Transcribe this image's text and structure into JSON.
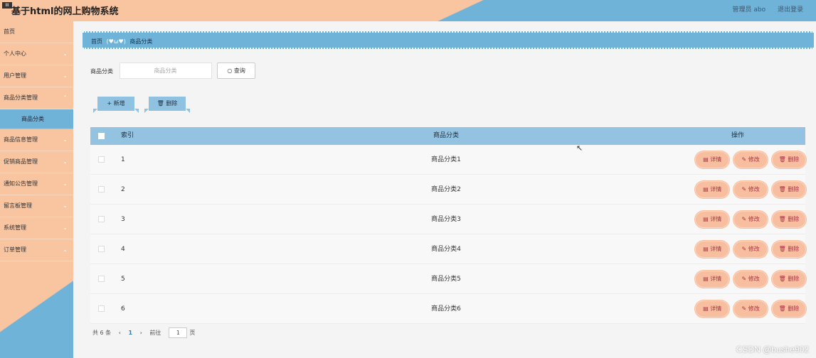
{
  "header": {
    "logo_text": "III",
    "title": "基于html的网上购物系统",
    "user_label": "管理员 abo",
    "logout_label": "退出登录"
  },
  "sidebar": {
    "items": [
      {
        "label": "首页",
        "chevron": false
      },
      {
        "label": "个人中心",
        "chevron": true
      },
      {
        "label": "用户管理",
        "chevron": true
      },
      {
        "label": "商品分类管理",
        "chevron": true
      },
      {
        "label": "商品分类",
        "sub": true
      },
      {
        "label": "商品信息管理",
        "chevron": true
      },
      {
        "label": "促销商品管理",
        "chevron": true
      },
      {
        "label": "通知公告管理",
        "chevron": true
      },
      {
        "label": "留言板管理",
        "chevron": true
      },
      {
        "label": "系统管理",
        "chevron": true
      },
      {
        "label": "订单管理",
        "chevron": true
      }
    ]
  },
  "breadcrumb": {
    "home": "首页",
    "decoration": "(♥ω♥)",
    "current": "商品分类"
  },
  "search": {
    "label": "商品分类",
    "placeholder": "商品分类",
    "query_button": "查询"
  },
  "actions": {
    "add_label": "新增",
    "delete_label": "删除"
  },
  "table": {
    "headers": {
      "index": "索引",
      "category": "商品分类",
      "ops": "操作"
    },
    "rows": [
      {
        "index": "1",
        "category": "商品分类1"
      },
      {
        "index": "2",
        "category": "商品分类2"
      },
      {
        "index": "3",
        "category": "商品分类3"
      },
      {
        "index": "4",
        "category": "商品分类4"
      },
      {
        "index": "5",
        "category": "商品分类5"
      },
      {
        "index": "6",
        "category": "商品分类6"
      }
    ],
    "row_buttons": {
      "detail": "详情",
      "edit": "修改",
      "delete": "删除"
    }
  },
  "pager": {
    "total": "共 6 条",
    "prev": "‹",
    "current_page": "1",
    "next": "›",
    "goto_label": "前往",
    "goto_value": "1",
    "page_suffix": "页"
  },
  "watermark": "CSDN @bushe902",
  "colors": {
    "peach": "#f9c4a0",
    "blue": "#6fb3d8",
    "table_header": "#93c3e0",
    "op_button": "#f7bfa0"
  }
}
